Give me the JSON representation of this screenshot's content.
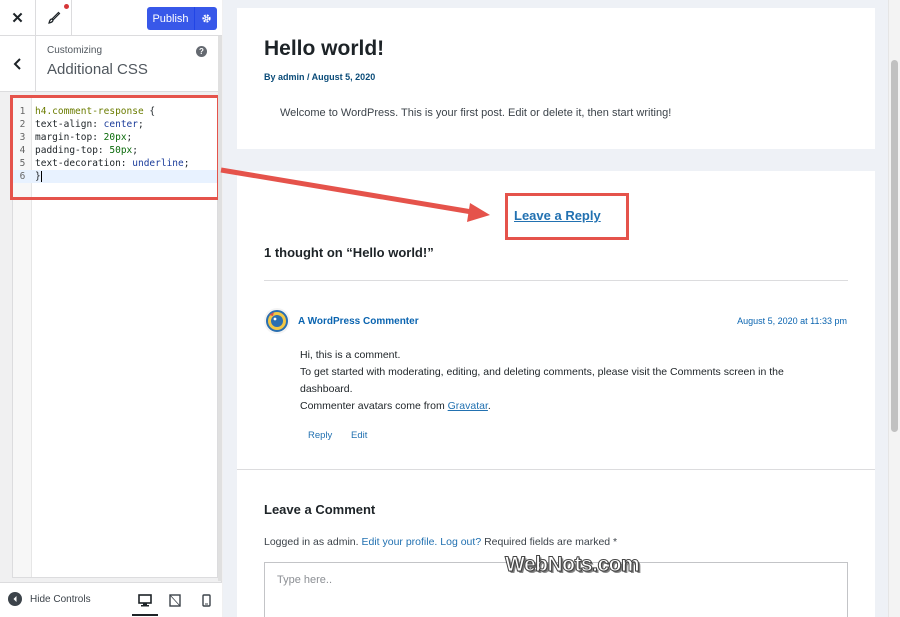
{
  "topbar": {
    "close_glyph": "✕",
    "publish_label": "Publish"
  },
  "section": {
    "breadcrumb": "Customizing",
    "title": "Additional CSS",
    "help_glyph": "?"
  },
  "css_editor": {
    "lines": [
      {
        "num": "1",
        "parts": [
          {
            "t": "h4",
            "c": "sel"
          },
          {
            "t": ".comment-response ",
            "c": "sel"
          },
          {
            "t": "{",
            "c": "br"
          }
        ]
      },
      {
        "num": "2",
        "parts": [
          {
            "t": "text-align",
            "c": "prop"
          },
          {
            "t": ": ",
            "c": "prop"
          },
          {
            "t": "center",
            "c": "kw"
          },
          {
            "t": ";",
            "c": "prop"
          }
        ]
      },
      {
        "num": "3",
        "parts": [
          {
            "t": "margin-top",
            "c": "prop"
          },
          {
            "t": ": ",
            "c": "prop"
          },
          {
            "t": "20px",
            "c": "val"
          },
          {
            "t": ";",
            "c": "prop"
          }
        ]
      },
      {
        "num": "4",
        "parts": [
          {
            "t": "padding-top",
            "c": "prop"
          },
          {
            "t": ": ",
            "c": "prop"
          },
          {
            "t": "50px",
            "c": "val"
          },
          {
            "t": ";",
            "c": "prop"
          }
        ]
      },
      {
        "num": "5",
        "parts": [
          {
            "t": "text-decoration",
            "c": "prop"
          },
          {
            "t": ": ",
            "c": "prop"
          },
          {
            "t": "underline",
            "c": "kw"
          },
          {
            "t": ";",
            "c": "prop"
          }
        ]
      },
      {
        "num": "6",
        "parts": [
          {
            "t": "}",
            "c": "br"
          }
        ]
      }
    ]
  },
  "footer": {
    "hide_controls_label": "Hide Controls"
  },
  "post": {
    "title": "Hello world!",
    "meta": "By admin / August 5, 2020",
    "body": "Welcome to WordPress. This is your first post. Edit or delete it, then start writing!"
  },
  "comments": {
    "leave_reply": "Leave a Reply",
    "heading": "1 thought on “Hello world!”",
    "commenter": "A WordPress Commenter",
    "date": "August 5, 2020 at 11:33 pm",
    "text_line1": "Hi, this is a comment.",
    "text_line2": "To get started with moderating, editing, and deleting comments, please visit the Comments screen in the dashboard.",
    "text_line3_prefix": "Commenter avatars come from ",
    "text_line3_link": "Gravatar",
    "text_line3_suffix": ".",
    "reply_label": "Reply",
    "edit_label": "Edit"
  },
  "comment_form": {
    "heading": "Leave a Comment",
    "logged_in_prefix": "Logged in as admin. ",
    "edit_profile": "Edit your profile.",
    "log_out": "Log out?",
    "required_note": " Required fields are marked *",
    "placeholder": "Type here.."
  },
  "watermark": "WebNots.com",
  "colors": {
    "publish_blue": "#3858e9",
    "link_blue": "#2271b1",
    "annotation_red": "#e5534b"
  }
}
